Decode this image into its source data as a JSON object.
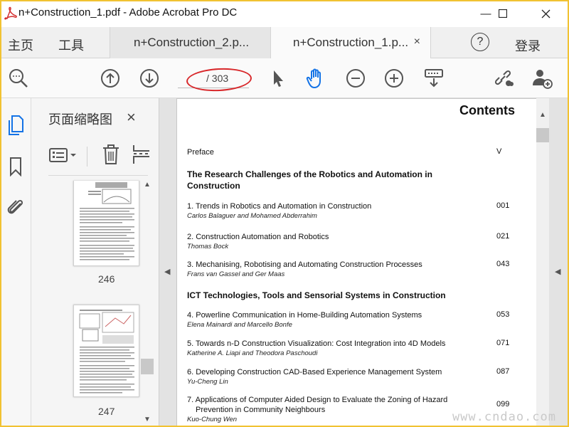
{
  "window": {
    "title": "n+Construction_1.pdf - Adobe Acrobat Pro DC",
    "minimize": "—",
    "maximize": "☐",
    "close": "✕"
  },
  "menu": {
    "home": "主页",
    "tools": "工具",
    "help": "?",
    "login": "登录"
  },
  "tabs": [
    {
      "label": "n+Construction_2.p..."
    },
    {
      "label": "n+Construction_1.p...",
      "close": "×"
    }
  ],
  "toolbar": {
    "page_current": "",
    "page_total": "/ 303"
  },
  "thumbnail_panel": {
    "title": "页面缩略图",
    "close": "×",
    "thumbs": [
      {
        "label": "246"
      },
      {
        "label": "247"
      }
    ]
  },
  "document": {
    "heading": "Contents",
    "preface": {
      "title": "Preface",
      "page": "V"
    },
    "sections": [
      "The Research Challenges of the Robotics and Automation in Construction",
      "ICT Technologies, Tools and Sensorial Systems in Construction"
    ],
    "entries": [
      {
        "title": "1. Trends in Robotics and Automation in Construction",
        "author": "Carlos Balaguer and Mohamed Abderrahim",
        "page": "001"
      },
      {
        "title": "2. Construction Automation and Robotics",
        "author": "Thomas Bock",
        "page": "021"
      },
      {
        "title": "3. Mechanising, Robotising and Automating Construction Processes",
        "author": "Frans van Gassel and Ger Maas",
        "page": "043"
      },
      {
        "title": "4. Powerline Communication in Home-Building Automation Systems",
        "author": "Elena Mainardi and Marcello Bonfe",
        "page": "053"
      },
      {
        "title": "5. Towards n-D Construction Visualization: Cost Integration into 4D Models",
        "author": "Katherine A. Liapi  and  Theodora Paschoudi",
        "page": "071"
      },
      {
        "title": "6. Developing Construction CAD-Based Experience Management System",
        "author": "Yu-Cheng Lin",
        "page": "087"
      },
      {
        "title": "7. Applications of Computer Aided Design to Evaluate the Zoning of Hazard",
        "title2": "Prevention in Community Neighbours",
        "author": "Kuo-Chung Wen",
        "page": "099"
      }
    ]
  },
  "watermark": "www.cndao.com",
  "colors": {
    "accent": "#1473e6",
    "annotation": "#d8282b",
    "frame": "#f1c232"
  }
}
